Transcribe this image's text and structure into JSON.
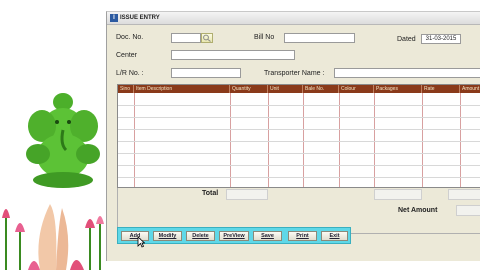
{
  "window": {
    "title": "ISSUE ENTRY",
    "icon": "app-icon"
  },
  "form": {
    "doc_no_label": "Doc. No.",
    "doc_no_value": "",
    "bill_no_label": "Bill No",
    "bill_no_value": "",
    "dated_label": "Dated",
    "dated_value": "31-03-2015",
    "center_label": "Center",
    "center_value": "",
    "lr_no_label": "L/R No. :",
    "lr_no_value": "",
    "transporter_label": "Transporter Name :",
    "transporter_value": ""
  },
  "grid": {
    "columns": [
      "Sino",
      "Item Description",
      "Quantity",
      "Unit",
      "Bale No.",
      "Colour",
      "Packages",
      "Rate",
      "Amount"
    ]
  },
  "totals": {
    "total_label": "Total",
    "net_amount_label": "Net Amount"
  },
  "buttons": {
    "add": "Add",
    "modify": "Modify",
    "delete": "Delete",
    "preview": "PreView",
    "save": "Save",
    "print": "Print",
    "exit": "Exit"
  },
  "colors": {
    "grid_header": "#8a3a1a",
    "button_bar": "#5fd8e8",
    "window_bg": "#ece9d8"
  }
}
